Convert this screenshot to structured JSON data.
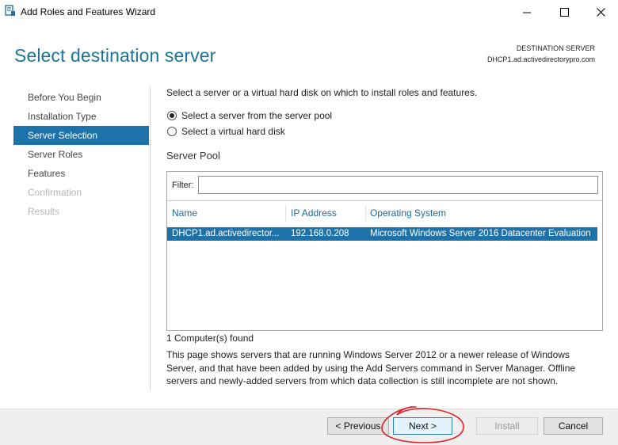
{
  "window": {
    "title": "Add Roles and Features Wizard",
    "icon": "server-manager-icon"
  },
  "header": {
    "page_title": "Select destination server",
    "dest_label": "DESTINATION SERVER",
    "dest_value": "DHCP1.ad.activedirectorypro.com"
  },
  "nav": {
    "items": [
      {
        "label": "Before You Begin",
        "state": "normal"
      },
      {
        "label": "Installation Type",
        "state": "normal"
      },
      {
        "label": "Server Selection",
        "state": "active"
      },
      {
        "label": "Server Roles",
        "state": "normal"
      },
      {
        "label": "Features",
        "state": "normal"
      },
      {
        "label": "Confirmation",
        "state": "disabled"
      },
      {
        "label": "Results",
        "state": "disabled"
      }
    ]
  },
  "content": {
    "intro": "Select a server or a virtual hard disk on which to install roles and features.",
    "radio_pool": "Select a server from the server pool",
    "radio_vhd": "Select a virtual hard disk",
    "pool_title": "Server Pool",
    "filter_label": "Filter:",
    "filter_value": "",
    "columns": [
      "Name",
      "IP Address",
      "Operating System"
    ],
    "rows": [
      {
        "name": "DHCP1.ad.activedirector...",
        "ip": "192.168.0.208",
        "os": "Microsoft Windows Server 2016 Datacenter Evaluation",
        "selected": true
      }
    ],
    "found": "1 Computer(s) found",
    "description": "This page shows servers that are running Windows Server 2012 or a newer release of Windows Server, and that have been added by using the Add Servers command in Server Manager. Offline servers and newly-added servers from which data collection is still incomplete are not shown."
  },
  "footer": {
    "previous": "< Previous",
    "next": "Next >",
    "install": "Install",
    "cancel": "Cancel"
  },
  "colors": {
    "accent": "#1d72aa",
    "title": "#1d7596",
    "annotation": "#e0242b"
  }
}
